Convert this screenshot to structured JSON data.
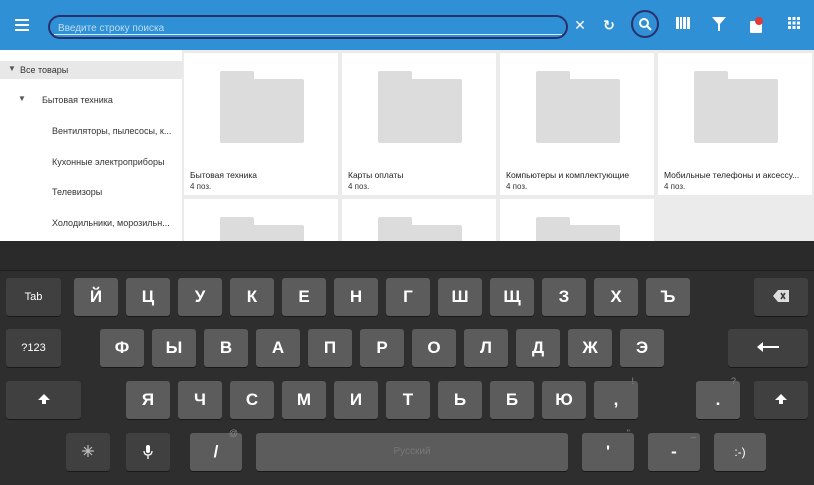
{
  "toolbar": {
    "search_placeholder": "Введите строку поиска",
    "clear_icon": "✕",
    "refresh_icon": "↻",
    "icons": [
      "menu-icon",
      "close-icon",
      "refresh-icon",
      "search-icon",
      "barcode-icon",
      "filter-icon",
      "cart-icon",
      "grid-icon"
    ],
    "accent": "#2f90d6"
  },
  "sidebar": {
    "items": [
      {
        "label": "Все товары",
        "marker": "▼"
      },
      {
        "label": "Бытовая техника",
        "marker": "▼"
      },
      {
        "label": "Вентиляторы, пылесосы, к..."
      },
      {
        "label": "Кухонные электроприборы"
      },
      {
        "label": "Телевизоры"
      },
      {
        "label": "Холодильники, морозильн..."
      }
    ]
  },
  "grid": {
    "tiles": [
      {
        "name": "Бытовая техника",
        "count": "4 поз."
      },
      {
        "name": "Карты оплаты",
        "count": "4 поз."
      },
      {
        "name": "Компьютеры и комплектующие",
        "count": "4 поз."
      },
      {
        "name": "Мобильные телефоны и аксессу...",
        "count": "4 поз."
      }
    ]
  },
  "keyboard": {
    "row1": {
      "tab": "Tab",
      "keys": [
        "Й",
        "Ц",
        "У",
        "К",
        "Е",
        "Н",
        "Г",
        "Ш",
        "Щ",
        "З",
        "Х",
        "Ъ"
      ]
    },
    "row2": {
      "sym": "?123",
      "keys": [
        "Ф",
        "Ы",
        "В",
        "А",
        "П",
        "Р",
        "О",
        "Л",
        "Д",
        "Ж",
        "Э"
      ]
    },
    "row3": {
      "keys": [
        "Я",
        "Ч",
        "С",
        "М",
        "И",
        "Т",
        "Ь",
        "Б",
        "Ю"
      ],
      "comma": ",",
      "comma_hint": "!",
      "period": ".",
      "period_hint": "?"
    },
    "row4": {
      "slash": "/",
      "slash_hint": "@",
      "space_label": "Русский",
      "apostrophe": "'",
      "apostrophe_hint": "\"",
      "dash": "-",
      "dash_hint": "_",
      "smiley": ":-)"
    }
  }
}
